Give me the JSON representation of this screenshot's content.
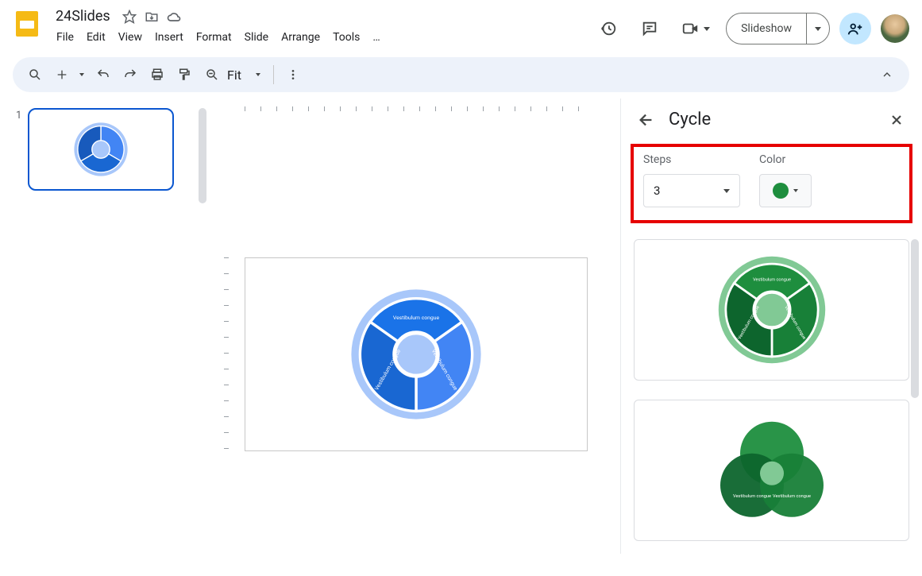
{
  "doc": {
    "title": "24Slides"
  },
  "menu": {
    "items": [
      "File",
      "Edit",
      "View",
      "Insert",
      "Format",
      "Slide",
      "Arrange",
      "Tools",
      "…"
    ]
  },
  "header": {
    "slideshow": "Slideshow"
  },
  "toolbar": {
    "zoom": "Fit"
  },
  "filmstrip": {
    "slides": [
      {
        "num": "1"
      }
    ]
  },
  "panel": {
    "title": "Cycle",
    "steps_label": "Steps",
    "steps_value": "3",
    "color_label": "Color",
    "color_value": "#1e8e3e"
  },
  "diagram": {
    "segment_label": "Vestibulum congue"
  }
}
